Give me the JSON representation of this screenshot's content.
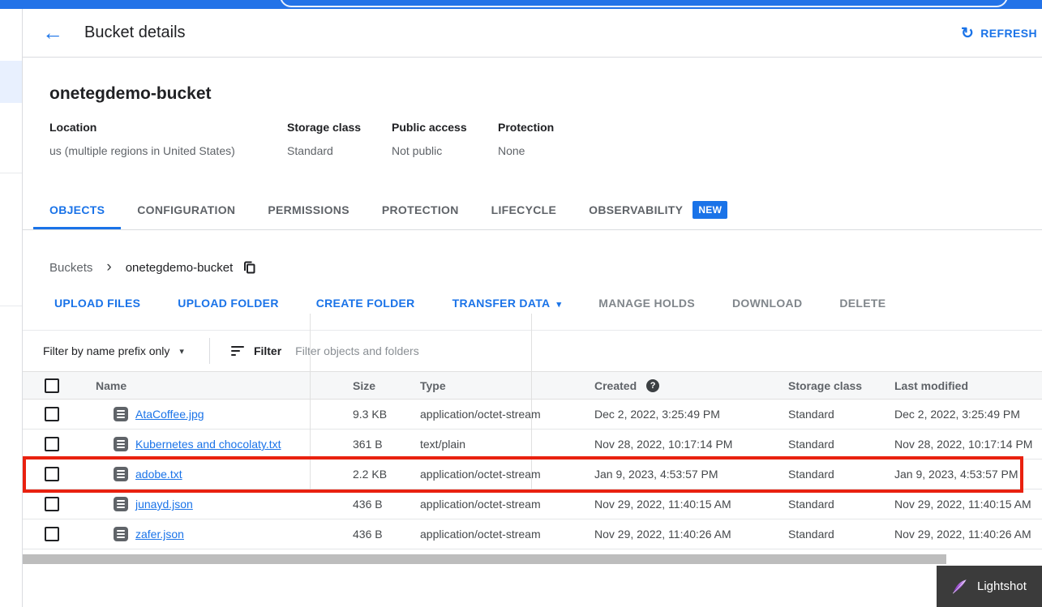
{
  "header": {
    "title": "Bucket details",
    "refresh_label": "REFRESH"
  },
  "bucket": {
    "name": "onetegdemo-bucket",
    "info": [
      {
        "label": "Location",
        "value": "us (multiple regions in United States)"
      },
      {
        "label": "Storage class",
        "value": "Standard"
      },
      {
        "label": "Public access",
        "value": "Not public"
      },
      {
        "label": "Protection",
        "value": "None"
      }
    ]
  },
  "tabs": [
    {
      "label": "OBJECTS",
      "active": true
    },
    {
      "label": "CONFIGURATION",
      "active": false
    },
    {
      "label": "PERMISSIONS",
      "active": false
    },
    {
      "label": "PROTECTION",
      "active": false
    },
    {
      "label": "LIFECYCLE",
      "active": false
    },
    {
      "label": "OBSERVABILITY",
      "active": false,
      "badge": "NEW"
    }
  ],
  "breadcrumb": {
    "parent": "Buckets",
    "current": "onetegdemo-bucket"
  },
  "actions": {
    "upload_files": "UPLOAD FILES",
    "upload_folder": "UPLOAD FOLDER",
    "create_folder": "CREATE FOLDER",
    "transfer_data": "TRANSFER DATA",
    "manage_holds": "MANAGE HOLDS",
    "download": "DOWNLOAD",
    "delete": "DELETE"
  },
  "filter": {
    "scope_label": "Filter by name prefix only",
    "filter_label": "Filter",
    "placeholder": "Filter objects and folders"
  },
  "table": {
    "columns": {
      "name": "Name",
      "size": "Size",
      "type": "Type",
      "created": "Created",
      "storage_class": "Storage class",
      "last_modified": "Last modified"
    },
    "rows": [
      {
        "name": "AtaCoffee.jpg",
        "size": "9.3 KB",
        "type": "application/octet-stream",
        "created": "Dec 2, 2022, 3:25:49 PM",
        "storage_class": "Standard",
        "last_modified": "Dec 2, 2022, 3:25:49 PM",
        "highlighted": false
      },
      {
        "name": "Kubernetes and chocolaty.txt",
        "size": "361 B",
        "type": "text/plain",
        "created": "Nov 28, 2022, 10:17:14 PM",
        "storage_class": "Standard",
        "last_modified": "Nov 28, 2022, 10:17:14 PM",
        "highlighted": false
      },
      {
        "name": "adobe.txt",
        "size": "2.2 KB",
        "type": "application/octet-stream",
        "created": "Jan 9, 2023, 4:53:57 PM",
        "storage_class": "Standard",
        "last_modified": "Jan 9, 2023, 4:53:57 PM",
        "highlighted": true
      },
      {
        "name": "junayd.json",
        "size": "436 B",
        "type": "application/octet-stream",
        "created": "Nov 29, 2022, 11:40:15 AM",
        "storage_class": "Standard",
        "last_modified": "Nov 29, 2022, 11:40:15 AM",
        "highlighted": false
      },
      {
        "name": "zafer.json",
        "size": "436 B",
        "type": "application/octet-stream",
        "created": "Nov 29, 2022, 11:40:26 AM",
        "storage_class": "Standard",
        "last_modified": "Nov 29, 2022, 11:40:26 AM",
        "highlighted": false
      }
    ]
  },
  "overlay": {
    "lightshot_label": "Lightshot"
  },
  "icons": {
    "back": "←",
    "refresh": "↻",
    "caret_down": "▾",
    "chevron_right": "›",
    "help": "?"
  },
  "colors": {
    "accent": "#1a73e8",
    "topbar_blue": "#2373e8",
    "highlight_red": "#e9210f",
    "badge_bg": "#1a73e8",
    "link": "#1a73e8"
  }
}
